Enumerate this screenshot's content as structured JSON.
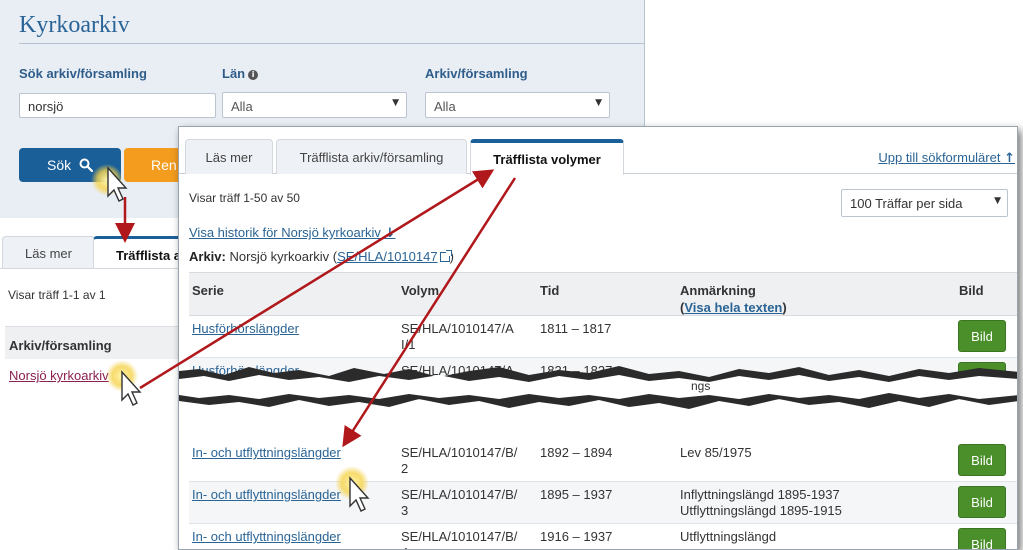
{
  "search": {
    "title": "Kyrkoarkiv",
    "field_sok_label": "Sök arkiv/församling",
    "field_sok_value": "norsjö",
    "field_lan_label": "Län",
    "field_lan_value": "Alla",
    "field_arkiv_label": "Arkiv/församling",
    "field_arkiv_value": "Alla",
    "search_button": "Sök",
    "reset_button": "Ren"
  },
  "back_results": {
    "tabs": [
      "Läs mer",
      "Träfflista a"
    ],
    "showing": "Visar träff 1-1 av 1",
    "column_header": "Arkiv/församling",
    "result_link": "Norsjö kyrkoarkiv"
  },
  "volumes": {
    "tabs": [
      "Läs mer",
      "Träfflista arkiv/församling",
      "Träfflista volymer"
    ],
    "up_link": "Upp till sökformuläret",
    "showing": "Visar träff 1-50 av 50",
    "per_page": "100 Träffar per sida",
    "history_link": "Visa historik för Norsjö kyrkoarkiv",
    "arkiv_label": "Arkiv:",
    "arkiv_name": "Norsjö kyrkoarkiv (",
    "arkiv_ref": "SE/HLA/1010147",
    "arkiv_close": ")",
    "columns": {
      "serie": "Serie",
      "volym": "Volym",
      "tid": "Tid",
      "anmarkning": "Anmärkning",
      "visa_open": "(",
      "visa_link": "Visa hela texten",
      "visa_close": ")",
      "bild": "Bild"
    },
    "rows": [
      {
        "serie": "Husförhörslängder",
        "volym": "SE/HLA/1010147/A I/1",
        "tid": "1811 – 1817",
        "anm": "",
        "bild": "Bild"
      },
      {
        "serie": "Husförhörslängder",
        "volym": "SE/HLA/1010147/A",
        "tid": "1831 – 1837",
        "anm": "",
        "bild": "Bild"
      },
      {
        "serie": "In- och utflyttningslängder",
        "volym": "SE/HLA/1010147/B/ 2",
        "tid": "1892 – 1894",
        "anm": "Lev 85/1975",
        "bild": "Bild"
      },
      {
        "serie": "In- och utflyttningslängder",
        "volym": "SE/HLA/1010147/B/ 3",
        "tid": "1895 – 1937",
        "anm": "Inflyttningslängd 1895-1937 Utflyttningslängd 1895-1915",
        "bild": "Bild"
      },
      {
        "serie": "In- och utflyttningslängder",
        "volym": "SE/HLA/1010147/B/ 4",
        "tid": "1916 – 1937",
        "anm": "Utflyttningslängd",
        "bild": "Bild"
      }
    ],
    "torn_fragment": "ngs"
  },
  "colors": {
    "primary_blue": "#1b5f98",
    "link_blue": "#2a6496",
    "orange": "#f39c1e",
    "green": "#4a8f2a",
    "arrow_red": "#b0181c",
    "visited_link": "#8b1f4e"
  }
}
